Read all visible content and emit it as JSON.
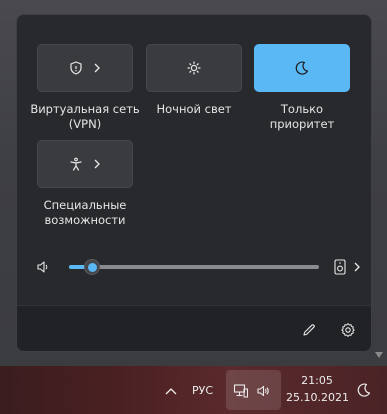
{
  "quick_settings": {
    "tiles": [
      {
        "label": "Виртуальная сеть (VPN)",
        "icon": "shield-icon",
        "has_chevron": true,
        "active": false
      },
      {
        "label": "Ночной свет",
        "icon": "brightness-icon",
        "has_chevron": false,
        "active": false
      },
      {
        "label": "Только приоритет",
        "icon": "moon-icon",
        "has_chevron": false,
        "active": true
      },
      {
        "label": "Специальные возможности",
        "icon": "accessibility-icon",
        "has_chevron": true,
        "active": false
      }
    ],
    "volume": {
      "level": 0.09,
      "icon": "speaker-icon",
      "device_icon": "speaker-device-icon",
      "chevron_icon": "chevron-right-icon"
    },
    "footer": {
      "edit_icon": "pencil-icon",
      "settings_icon": "gear-icon"
    }
  },
  "taskbar": {
    "overflow_icon": "chevron-up-icon",
    "language": "РУС",
    "network_icon": "network-icon",
    "volume_icon": "speaker-icon",
    "time": "21:05",
    "date": "25.10.2021",
    "focus_icon": "moon-icon"
  },
  "colors": {
    "accent": "#5ab9f5",
    "panel_bg": "#27292d",
    "tile_bg": "#3a3b3f"
  }
}
